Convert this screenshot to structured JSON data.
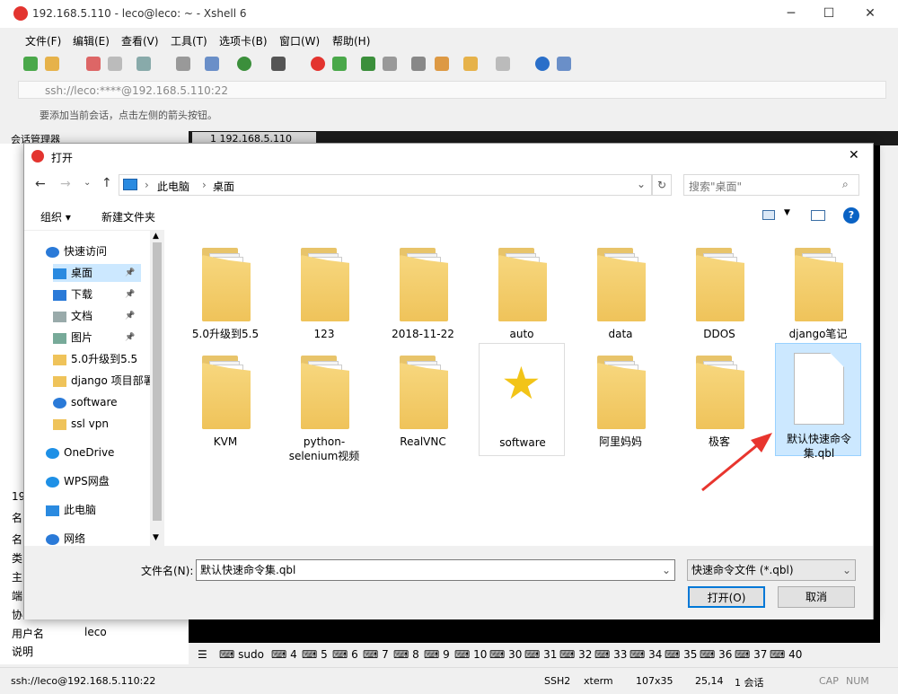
{
  "window": {
    "title": "192.168.5.110 - leco@leco: ~ - Xshell 6",
    "minimize": "─",
    "maximize": "☐",
    "close": "✕"
  },
  "menu": [
    "文件(F)",
    "编辑(E)",
    "查看(V)",
    "工具(T)",
    "选项卡(B)",
    "窗口(W)",
    "帮助(H)"
  ],
  "address": "ssh://leco:****@192.168.5.110:22",
  "hint": "要添加当前会话，点击左侧的箭头按钮。",
  "session_manager": "会话管理器",
  "tab": {
    "label": "1 192.168.5.110",
    "close": "×",
    "add": "+"
  },
  "left_panel": {
    "rows": [
      "19",
      "名",
      "名",
      "类",
      "主",
      "端",
      "协"
    ],
    "user_label": "用户名",
    "user_value": "leco",
    "desc_label": "说明",
    "collapse": "⊟"
  },
  "dialog": {
    "title": "打开",
    "close": "✕",
    "path": [
      "此电脑",
      "桌面"
    ],
    "search_placeholder": "搜索\"桌面\"",
    "organize": "组织 ▾",
    "new_folder": "新建文件夹",
    "nav_items": [
      {
        "label": "快速访问",
        "icon": "star-icon"
      },
      {
        "label": "桌面",
        "icon": "desktop-icon",
        "pinned": true,
        "selected": true
      },
      {
        "label": "下载",
        "icon": "download-icon",
        "pinned": true
      },
      {
        "label": "文档",
        "icon": "document-icon",
        "pinned": true
      },
      {
        "label": "图片",
        "icon": "picture-icon",
        "pinned": true
      },
      {
        "label": "5.0升级到5.5",
        "icon": "folder-icon"
      },
      {
        "label": "django 项目部署",
        "icon": "folder-icon"
      },
      {
        "label": "software",
        "icon": "star-icon"
      },
      {
        "label": "ssl vpn",
        "icon": "folder-icon"
      },
      {
        "label": "OneDrive",
        "icon": "cloud-icon"
      },
      {
        "label": "WPS网盘",
        "icon": "cloud-icon"
      },
      {
        "label": "此电脑",
        "icon": "computer-icon"
      },
      {
        "label": "网络",
        "icon": "network-icon"
      }
    ],
    "files": [
      {
        "label": "5.0升级到5.5",
        "type": "folder"
      },
      {
        "label": "123",
        "type": "folder"
      },
      {
        "label": "2018-11-22",
        "type": "folder"
      },
      {
        "label": "auto",
        "type": "folder"
      },
      {
        "label": "data",
        "type": "folder"
      },
      {
        "label": "DDOS",
        "type": "folder"
      },
      {
        "label": "django笔记",
        "type": "folder"
      },
      {
        "label": "KVM",
        "type": "folder"
      },
      {
        "label": "python-selenium视频",
        "type": "folder"
      },
      {
        "label": "RealVNC",
        "type": "folder"
      },
      {
        "label": "software",
        "type": "shortcut"
      },
      {
        "label": "阿里妈妈",
        "type": "folder"
      },
      {
        "label": "极客",
        "type": "folder"
      },
      {
        "label": "默认快速命令集.qbl",
        "type": "file",
        "selected": true
      }
    ],
    "filename_label": "文件名(N):",
    "filename_value": "默认快速命令集.qbl",
    "filetype_value": "快速命令文件 (*.qbl)",
    "open_button": "打开(O)",
    "cancel_button": "取消"
  },
  "cmdbar": [
    "sudo",
    "4",
    "5",
    "6",
    "7",
    "8",
    "9",
    "10",
    "30",
    "31",
    "32",
    "33",
    "34",
    "35",
    "36",
    "37",
    "40"
  ],
  "status": {
    "conn": "ssh://leco@192.168.5.110:22",
    "proto": "SSH2",
    "term": "xterm",
    "size": "107x35",
    "pos": "25,14",
    "sessions": "1 会话",
    "caps": "CAP",
    "num": "NUM"
  },
  "colors": {
    "accent": "#0078d7",
    "selection": "#cce8ff",
    "arrow": "#e8352e",
    "folder": "#efc35a"
  }
}
